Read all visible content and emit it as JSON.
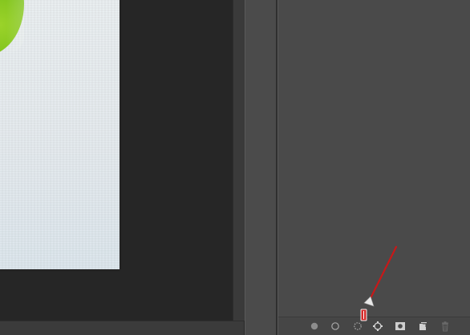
{
  "document": {
    "subject": "green-apple-on-white-paper"
  },
  "paths_panel": {
    "footer_buttons": [
      {
        "name": "fill-path-button",
        "icon": "filled-circle-icon"
      },
      {
        "name": "stroke-path-button",
        "icon": "stroke-circle-icon"
      },
      {
        "name": "load-path-as-selection-button",
        "icon": "dashed-circle-selection-icon"
      },
      {
        "name": "make-work-path-button",
        "icon": "work-path-icon"
      },
      {
        "name": "add-mask-button",
        "icon": "mask-icon"
      },
      {
        "name": "create-new-path-button",
        "icon": "new-layer-icon"
      },
      {
        "name": "delete-path-button",
        "icon": "trash-icon"
      }
    ]
  },
  "colors": {
    "panel_bg": "#4a4a4a",
    "canvas_bg": "#262626",
    "icon_color": "#a8a8a8",
    "annotation_arrow": "#d01a1a"
  }
}
